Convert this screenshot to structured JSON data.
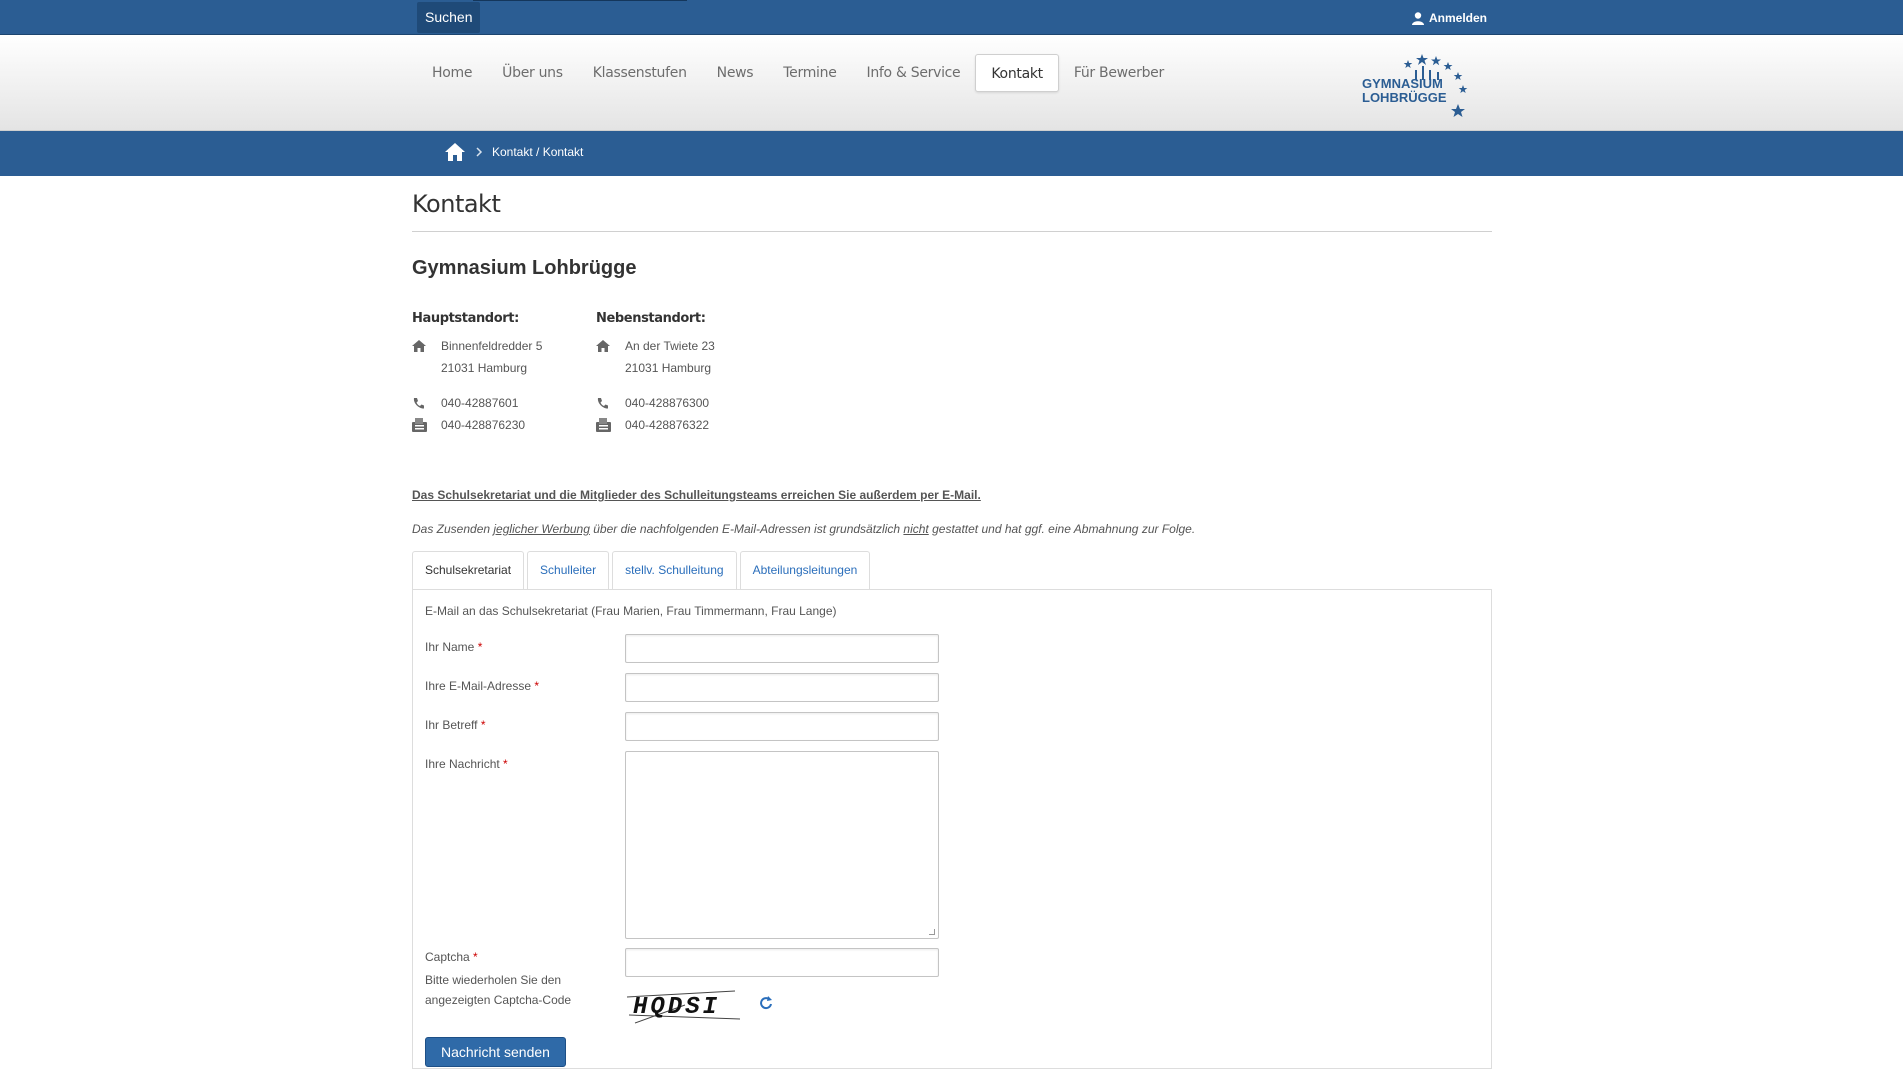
{
  "topbar": {
    "search_label": "Suchen",
    "login_label": "Anmelden"
  },
  "nav": {
    "items": [
      {
        "label": "Home"
      },
      {
        "label": "Über uns"
      },
      {
        "label": "Klassenstufen"
      },
      {
        "label": "News"
      },
      {
        "label": "Termine"
      },
      {
        "label": "Info & Service"
      },
      {
        "label": "Kontakt",
        "active": true
      },
      {
        "label": "Für Bewerber"
      }
    ]
  },
  "logo": {
    "line1": "GYMNASIUM",
    "line2": "LOHBRÜGGE"
  },
  "breadcrumb": {
    "path": "Kontakt / Kontakt"
  },
  "page": {
    "title": "Kontakt",
    "org_name": "Gymnasium Lohbrügge",
    "locations": [
      {
        "heading": "Hauptstandort:",
        "street": "Binnenfeldredder 5",
        "city": "21031 Hamburg",
        "phone": "040-42887601",
        "fax": "040-428876230"
      },
      {
        "heading": "Nebenstandort:",
        "street": "An der Twiete 23",
        "city": "21031 Hamburg",
        "phone": "040-428876300",
        "fax": "040-428876322"
      }
    ],
    "notice": "Das Schulsekretariat und die Mitglieder des Schulleitungsteams erreichen Sie außerdem per E-Mail.",
    "warning": {
      "part1": "Das Zusenden ",
      "link1": "jeglicher Werbung",
      "part2": " über die nachfolgenden E-Mail-Adressen ist grundsätzlich ",
      "link2": "nicht",
      "part3": " gestattet und hat ggf. eine Abmahnung zur Folge."
    }
  },
  "tabs": [
    {
      "label": "Schulsekretariat",
      "active": true
    },
    {
      "label": "Schulleiter"
    },
    {
      "label": "stellv. Schulleitung"
    },
    {
      "label": "Abteilungsleitungen"
    }
  ],
  "form": {
    "intro": "E-Mail an das Schulsekretariat (Frau Marien, Frau Timmermann, Frau Lange)",
    "name_label": "Ihr Name",
    "email_label": "Ihre E-Mail-Adresse",
    "subject_label": "Ihr Betreff",
    "message_label": "Ihre Nachricht",
    "captcha_label": "Captcha",
    "captcha_help": "Bitte wiederholen Sie den angezeigten Captcha-Code",
    "captcha_code": "HQDSI",
    "required_mark": "*",
    "submit_label": "Nachricht senden"
  },
  "colors": {
    "brand_blue": "#2b5d93",
    "link_blue": "#2a6ebb",
    "required_red": "#cc0000"
  }
}
